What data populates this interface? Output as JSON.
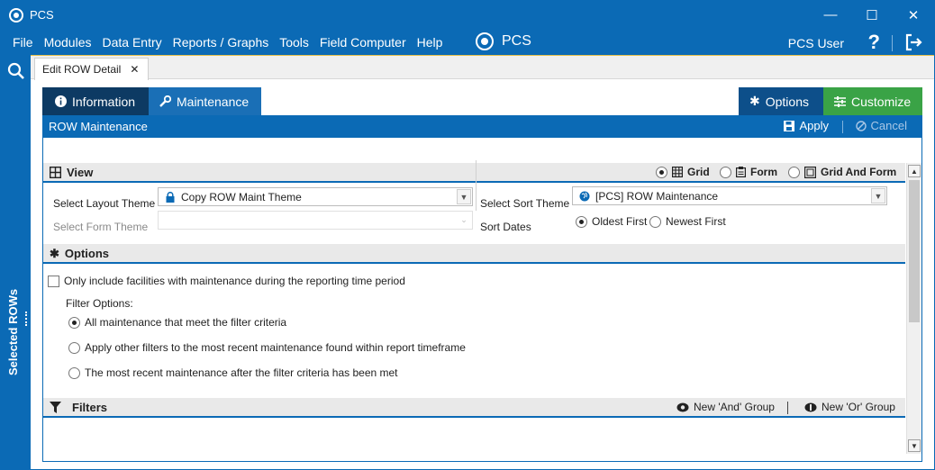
{
  "window": {
    "title": "PCS",
    "controls": {
      "minimize": "—",
      "maximize": "☐",
      "close": "✕"
    }
  },
  "menu": {
    "items": [
      "File",
      "Modules",
      "Data Entry",
      "Reports / Graphs",
      "Tools",
      "Field Computer",
      "Help"
    ],
    "brand": "PCS",
    "user": "PCS User",
    "help": "?"
  },
  "sidebar": {
    "label": "Selected ROWs"
  },
  "doc_tab": {
    "label": "Edit ROW Detail",
    "close": "✕"
  },
  "tabs": {
    "information": "Information",
    "maintenance": "Maintenance",
    "options": "Options",
    "customize": "Customize"
  },
  "section_title": "ROW Maintenance",
  "actions": {
    "apply": "Apply",
    "cancel": "Cancel"
  },
  "view": {
    "header": "View",
    "modes": [
      "Grid",
      "Form",
      "Grid And Form"
    ],
    "selected_mode": "Grid",
    "select_layout_theme_label": "Select Layout Theme",
    "layout_theme_value": "Copy ROW Maint Theme",
    "select_form_theme_label": "Select Form Theme",
    "form_theme_value": "",
    "select_sort_theme_label": "Select Sort Theme",
    "sort_theme_value": "[PCS] ROW Maintenance",
    "sort_dates_label": "Sort Dates",
    "sort_dates_options": [
      "Oldest First",
      "Newest First"
    ],
    "sort_dates_selected": "Oldest First"
  },
  "options": {
    "header": "Options",
    "only_include_label": "Only include facilities with maintenance during the reporting time period",
    "only_include_checked": false,
    "filter_options_label": "Filter Options:",
    "filter_choices": [
      "All maintenance that meet the filter criteria",
      "Apply other filters to the most recent maintenance found within report timeframe",
      "The most recent maintenance after the filter criteria has been met"
    ],
    "filter_selected_index": 0
  },
  "filters": {
    "header": "Filters",
    "new_and_group": "New 'And' Group",
    "new_or_group": "New 'Or' Group"
  },
  "colors": {
    "primary": "#0b6ab5",
    "dark_tab": "#0d3a63",
    "options_tab": "#0d4f8a",
    "customize_tab": "#3aa346"
  }
}
